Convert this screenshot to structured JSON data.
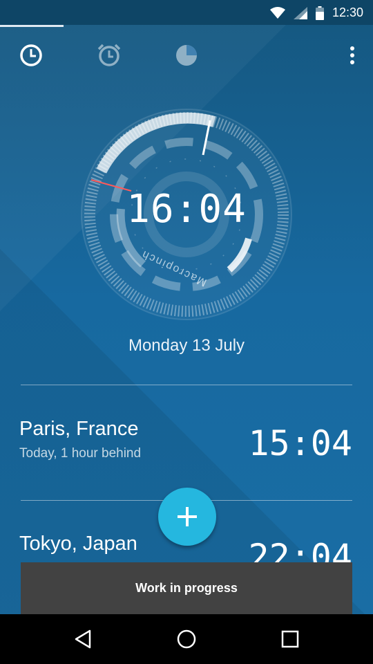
{
  "status_bar": {
    "time": "12:30"
  },
  "tabs": [
    {
      "icon": "clock-icon",
      "selected": true
    },
    {
      "icon": "alarm-icon",
      "selected": false
    },
    {
      "icon": "timer-icon",
      "selected": false
    }
  ],
  "clock": {
    "time": "16:04",
    "brand": "Macropinch",
    "date": "Monday 13 July"
  },
  "cities": [
    {
      "name": "Paris, France",
      "relative": "Today, 1 hour behind",
      "time": "15:04"
    },
    {
      "name": "Tokyo, Japan",
      "relative": "",
      "time": "22:04"
    }
  ],
  "fab": {
    "icon": "plus-icon"
  },
  "snackbar": {
    "text": "Work in progress"
  },
  "colors": {
    "accent": "#25b7df",
    "background": "#1769a0",
    "snackbar": "#424242"
  }
}
